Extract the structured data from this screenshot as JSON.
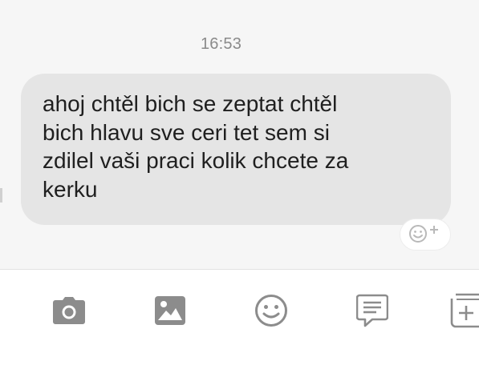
{
  "conversation": {
    "timestamp": "16:53",
    "message": {
      "text": "ahoj chtěl bich se zeptat chtěl\nbich hlavu sve ceri tet sem si\nzdilel vaši praci kolik chcete za\nkerku"
    },
    "reaction_button": {
      "icon": "emoji-add-icon"
    }
  },
  "toolbar": {
    "items": [
      {
        "name": "camera",
        "icon": "camera-icon"
      },
      {
        "name": "gallery",
        "icon": "image-icon"
      },
      {
        "name": "emoji",
        "icon": "smiley-icon"
      },
      {
        "name": "quick-reply",
        "icon": "message-template-icon"
      },
      {
        "name": "more",
        "icon": "add-box-icon"
      }
    ]
  },
  "colors": {
    "chat_background": "#f6f6f6",
    "bubble": "#e5e5e5",
    "text": "#1f1f1f",
    "timestamp": "#8a8a8a",
    "icon": "#8c8c8c"
  }
}
